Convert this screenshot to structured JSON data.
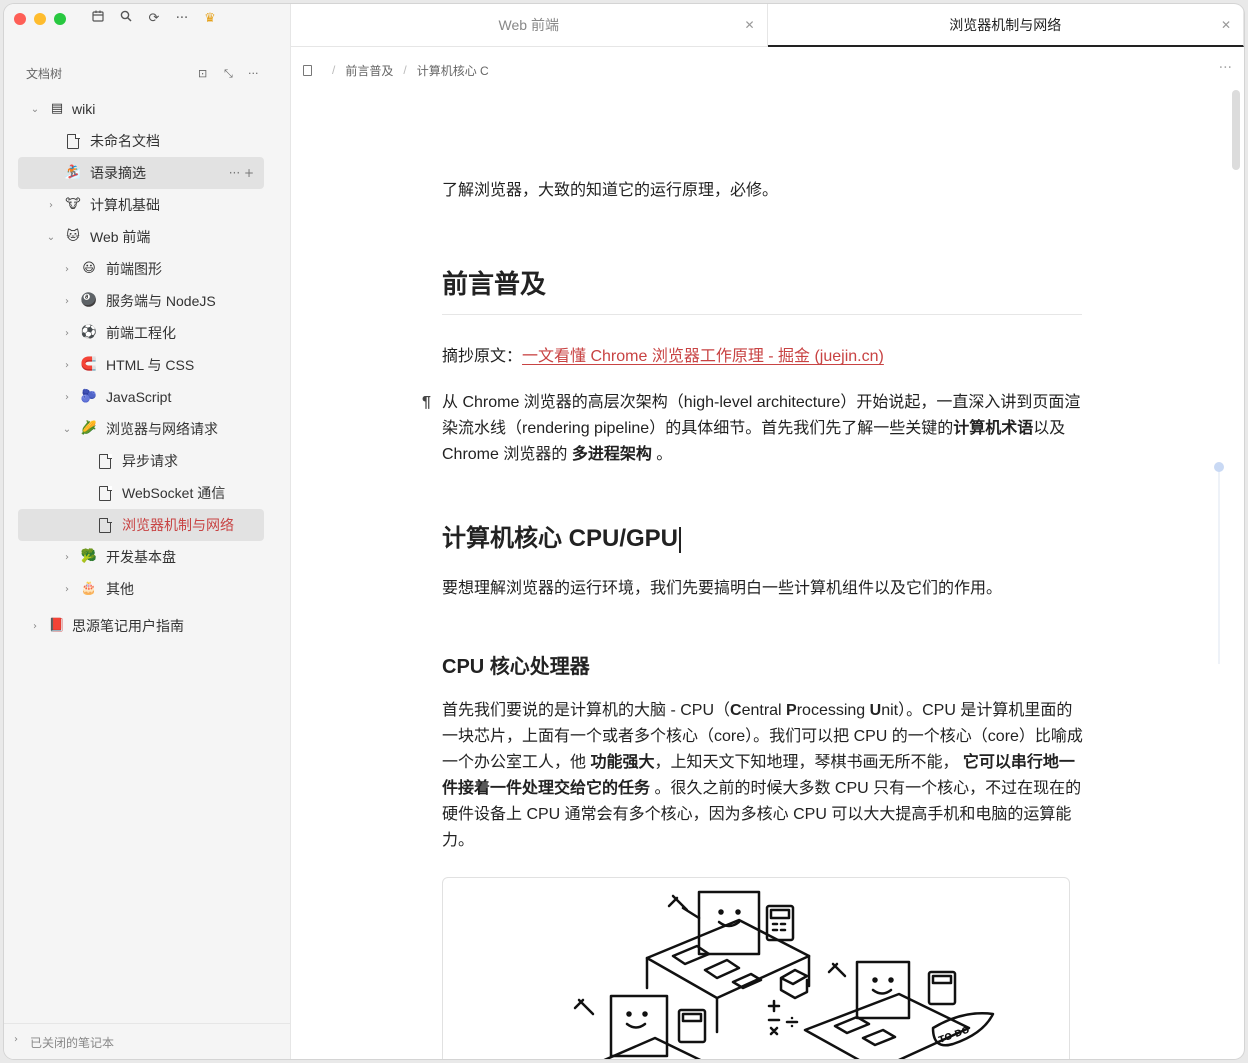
{
  "window": {
    "toolbar_icons": [
      "calendar-icon",
      "search-icon",
      "sync-icon",
      "more-icon",
      "crown-icon"
    ]
  },
  "sidebar": {
    "header_title": "文档树",
    "header_icons": [
      "focus-icon",
      "collapse-icon",
      "more-icon"
    ],
    "tree": [
      {
        "label": "wiki",
        "icon": "▤",
        "level": 0,
        "arrow": "⌄",
        "selected": false,
        "active": false
      },
      {
        "label": "未命名文档",
        "icon": "doc",
        "level": 1,
        "arrow": "",
        "selected": false,
        "active": false
      },
      {
        "label": "语录摘选",
        "icon": "🏂",
        "level": 1,
        "arrow": "",
        "selected": true,
        "active": false,
        "actions": "···   +"
      },
      {
        "label": "计算机基础",
        "icon": "🐮",
        "level": 1,
        "arrow": "›",
        "selected": false,
        "active": false
      },
      {
        "label": "Web 前端",
        "icon": "🐱",
        "level": 1,
        "arrow": "⌄",
        "selected": false,
        "active": false
      },
      {
        "label": "前端图形",
        "icon": "😃",
        "level": 2,
        "arrow": "›",
        "selected": false,
        "active": false
      },
      {
        "label": "服务端与 NodeJS",
        "icon": "🎱",
        "level": 2,
        "arrow": "›",
        "selected": false,
        "active": false
      },
      {
        "label": "前端工程化",
        "icon": "⚽",
        "level": 2,
        "arrow": "›",
        "selected": false,
        "active": false
      },
      {
        "label": "HTML 与 CSS",
        "icon": "🧲",
        "level": 2,
        "arrow": "›",
        "selected": false,
        "active": false
      },
      {
        "label": "JavaScript",
        "icon": "🫐",
        "level": 2,
        "arrow": "›",
        "selected": false,
        "active": false
      },
      {
        "label": "浏览器与网络请求",
        "icon": "🌽",
        "level": 2,
        "arrow": "⌄",
        "selected": false,
        "active": false
      },
      {
        "label": "异步请求",
        "icon": "doc",
        "level": 3,
        "arrow": "",
        "selected": false,
        "active": false
      },
      {
        "label": "WebSocket 通信",
        "icon": "doc",
        "level": 3,
        "arrow": "",
        "selected": false,
        "active": false
      },
      {
        "label": "浏览器机制与网络",
        "icon": "doc",
        "level": 3,
        "arrow": "",
        "selected": true,
        "active": true
      },
      {
        "label": "开发基本盘",
        "icon": "🥦",
        "level": 2,
        "arrow": "›",
        "selected": false,
        "active": false
      },
      {
        "label": "其他",
        "icon": "🎂",
        "level": 2,
        "arrow": "›",
        "selected": false,
        "active": false
      },
      {
        "label": "思源笔记用户指南",
        "icon": "📕",
        "level": 0,
        "arrow": "›",
        "selected": false,
        "active": false
      }
    ],
    "footer_label": "已关闭的笔记本"
  },
  "tabs": [
    {
      "label": "Web 前端",
      "active": false
    },
    {
      "label": "浏览器机制与网络",
      "active": true
    }
  ],
  "breadcrumb": [
    "前言普及",
    "计算机核心 C"
  ],
  "document": {
    "intro": "了解浏览器，大致的知道它的运行原理，必修。",
    "h_preface": "前言普及",
    "excerpt_prefix": "摘抄原文：",
    "excerpt_link": "一文看懂 Chrome 浏览器工作原理 - 掘金 (juejin.cn)",
    "para1_a": "从 Chrome 浏览器的高层次架构（high-level architecture）开始说起，一直深入讲到页面渲染流水线（rendering pipeline）的具体细节。首先我们先了解一些关键的",
    "para1_b": "计算机术语",
    "para1_c": "以及 Chrome 浏览器的 ",
    "para1_d": "多进程架构",
    "para1_e": " 。",
    "h_core": "计算机核心 CPU/GPU",
    "para2": "要想理解浏览器的运行环境，我们先要搞明白一些计算机组件以及它们的作用。",
    "h_cpu": "CPU 核心处理器",
    "para3_a": "首先我们要说的是计算机的大脑 - CPU（",
    "para3_C": "C",
    "para3_b": "entral ",
    "para3_P": "P",
    "para3_c": "rocessing ",
    "para3_U": "U",
    "para3_d": "nit）。CPU 是计算机里面的一块芯片，上面有一个或者多个核心（core）。我们可以把 CPU 的一个核心（core）比喻成一个办公室工人，他 ",
    "para3_e": "功能强大",
    "para3_f": "，上知天文下知地理，琴棋书画无所不能， ",
    "para3_g": "它可以串行地一件接着一件处理交给它的任务",
    "para3_h": " 。很久之前的时候大多数 CPU 只有一个核心，不过在现在的硬件设备上 CPU 通常会有多个核心，因为多核心 CPU 可以大大提高手机和电脑的运算能力。",
    "image_caption": "TO DO"
  }
}
